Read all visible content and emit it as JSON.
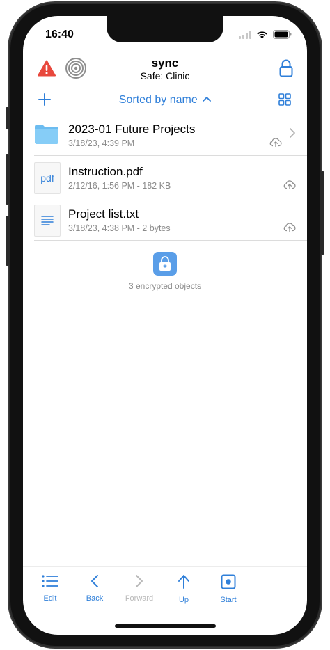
{
  "status_bar": {
    "time": "16:40"
  },
  "header": {
    "title": "sync",
    "subtitle": "Safe: Clinic"
  },
  "icons": {
    "warning": "warning-triangle-icon",
    "target": "target-icon",
    "lock": "lock-icon",
    "add": "plus-icon",
    "grid": "grid-view-icon"
  },
  "sort": {
    "label": "Sorted by name",
    "direction_icon": "chevron-up-icon"
  },
  "files": [
    {
      "name": "2023-01 Future Projects",
      "meta": "3/18/23, 4:39 PM",
      "type": "folder",
      "has_chevron": true
    },
    {
      "name": "Instruction.pdf",
      "meta": "2/12/16, 1:56 PM - 182 KB",
      "type": "pdf",
      "thumb_label": "pdf"
    },
    {
      "name": "Project list.txt",
      "meta": "3/18/23, 4:38 PM - 2 bytes",
      "type": "text"
    }
  ],
  "encrypted": {
    "text": "3 encrypted objects"
  },
  "toolbar": {
    "edit": "Edit",
    "back": "Back",
    "forward": "Forward",
    "up": "Up",
    "start": "Start"
  },
  "colors": {
    "accent": "#2f7fd9",
    "warning": "#e8483d",
    "disabled": "#b8b8b8"
  }
}
